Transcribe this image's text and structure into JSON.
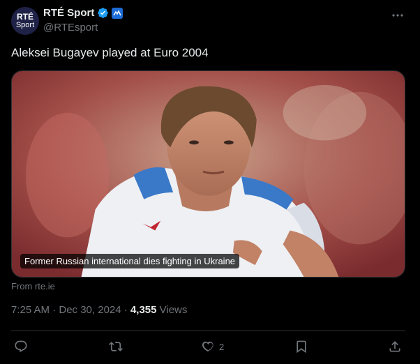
{
  "account": {
    "avatar_line1": "RTÉ",
    "avatar_line2": "Sport",
    "display_name": "RTÉ Sport",
    "handle": "@RTEsport"
  },
  "tweet": {
    "text": "Aleksei Bugayev played at Euro 2004",
    "card_caption": "Former Russian international dies fighting in Ukraine",
    "source": "From rte.ie",
    "timestamp": "7:25 AM · Dec 30, 2024 · ",
    "views_count": "4,355",
    "views_label": " Views"
  },
  "actions": {
    "likes_count": "2"
  },
  "colors": {
    "background": "#000000",
    "text": "#e7e9ea",
    "muted": "#71767b",
    "verified": "#1d9bf0",
    "divider": "#2f3336"
  },
  "icons": [
    "verified-badge-icon",
    "affiliate-badge-icon",
    "more-icon",
    "reply-icon",
    "retweet-icon",
    "like-icon",
    "bookmark-icon",
    "share-icon"
  ]
}
